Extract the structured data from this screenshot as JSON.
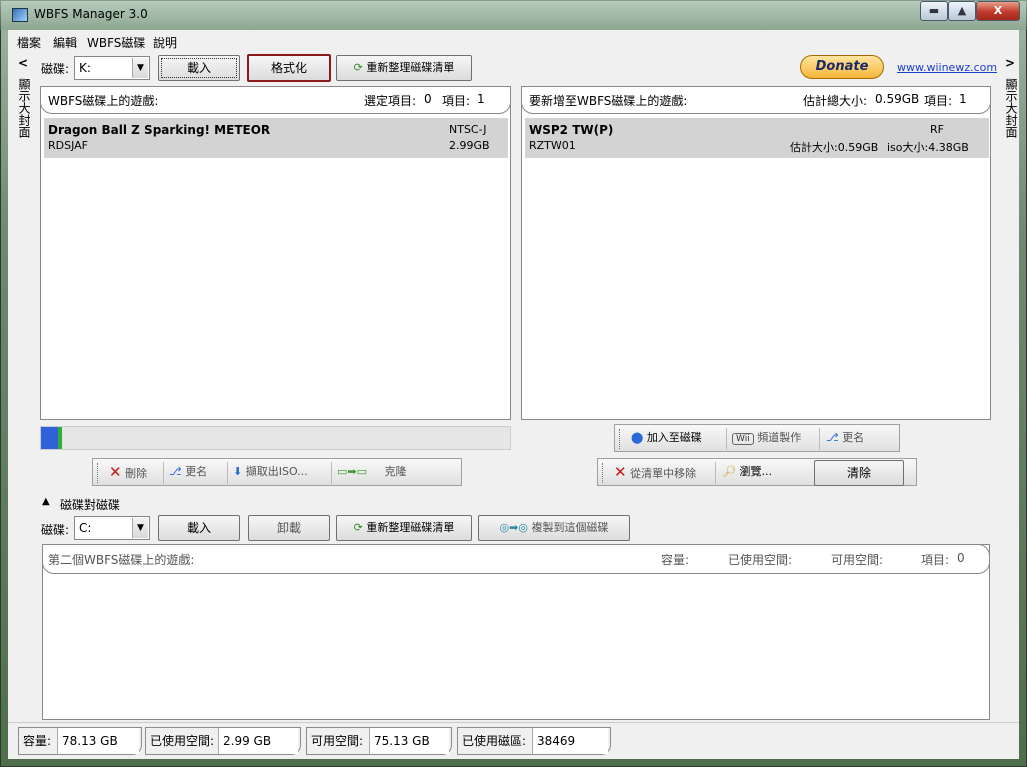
{
  "window": {
    "title": "WBFS Manager 3.0",
    "minimize": "▬",
    "maximize": "▲",
    "close": "X"
  },
  "menu": [
    "檔案",
    "編輯",
    "WBFS磁碟",
    "說明"
  ],
  "top": {
    "collapse_left": "<",
    "collapse_right": ">",
    "drive_label": "磁碟:",
    "drive_value": "K:",
    "load_button": "載入",
    "format_button": "格式化",
    "refresh_button": "重新整理磁碟清單",
    "donate": "Donate",
    "site_link": "www.wiinewz.com",
    "side_left": "顯示大封面",
    "side_right": "顯示大封面"
  },
  "left_panel": {
    "title": "WBFS磁碟上的遊戲:",
    "selected_label": "選定項目:",
    "selected_value": "0",
    "items_label": "項目:",
    "items_value": "1",
    "rows": [
      {
        "name": "Dragon Ball Z Sparking! METEOR",
        "region": "NTSC-J",
        "id": "RDSJAF",
        "size": "2.99GB"
      }
    ],
    "progress": 0.045
  },
  "right_panel": {
    "title": "要新增至WBFS磁碟上的遊戲:",
    "total_label": "估計總大小:",
    "total_value": "0.59GB",
    "items_label": "項目:",
    "items_value": "1",
    "rows": [
      {
        "name": "WSP2 TW(P)",
        "region": "RF",
        "id": "RZTW01",
        "est": "估計大小:0.59GB",
        "iso": "iso大小:4.38GB"
      }
    ]
  },
  "toolbar_right_top": {
    "add": "加入至磁碟",
    "make": "頻道製作",
    "rename": "更名"
  },
  "toolbar_right_bottom": {
    "remove": "從清單中移除",
    "browse": "瀏覽...",
    "clear": "清除"
  },
  "toolbar_left": {
    "delete": "刪除",
    "rename": "更名",
    "extract": "擷取出ISO...",
    "clone": "克隆"
  },
  "drive_to_drive": {
    "section_label": "磁碟對磁碟",
    "drive_label": "磁碟:",
    "drive_value": "C:",
    "load_button": "載入",
    "unload_button": "卸載",
    "refresh_button": "重新整理磁碟清單",
    "copy_button": "複製到這個磁碟",
    "panel_title": "第二個WBFS磁碟上的遊戲:",
    "capacity_label": "容量:",
    "used_label": "已使用空間:",
    "free_label": "可用空間:",
    "items_label": "項目:",
    "items_value": "0"
  },
  "status": {
    "capacity_label": "容量:",
    "capacity_value": "78.13 GB",
    "used_label": "已使用空間:",
    "used_value": "2.99 GB",
    "free_label": "可用空間:",
    "free_value": "75.13 GB",
    "blocks_label": "已使用磁區:",
    "blocks_value": "38469"
  },
  "colors": {
    "accent": "#2f62d8",
    "progress_green": "#2fae3a",
    "focus_border": "#8b1a1a"
  }
}
